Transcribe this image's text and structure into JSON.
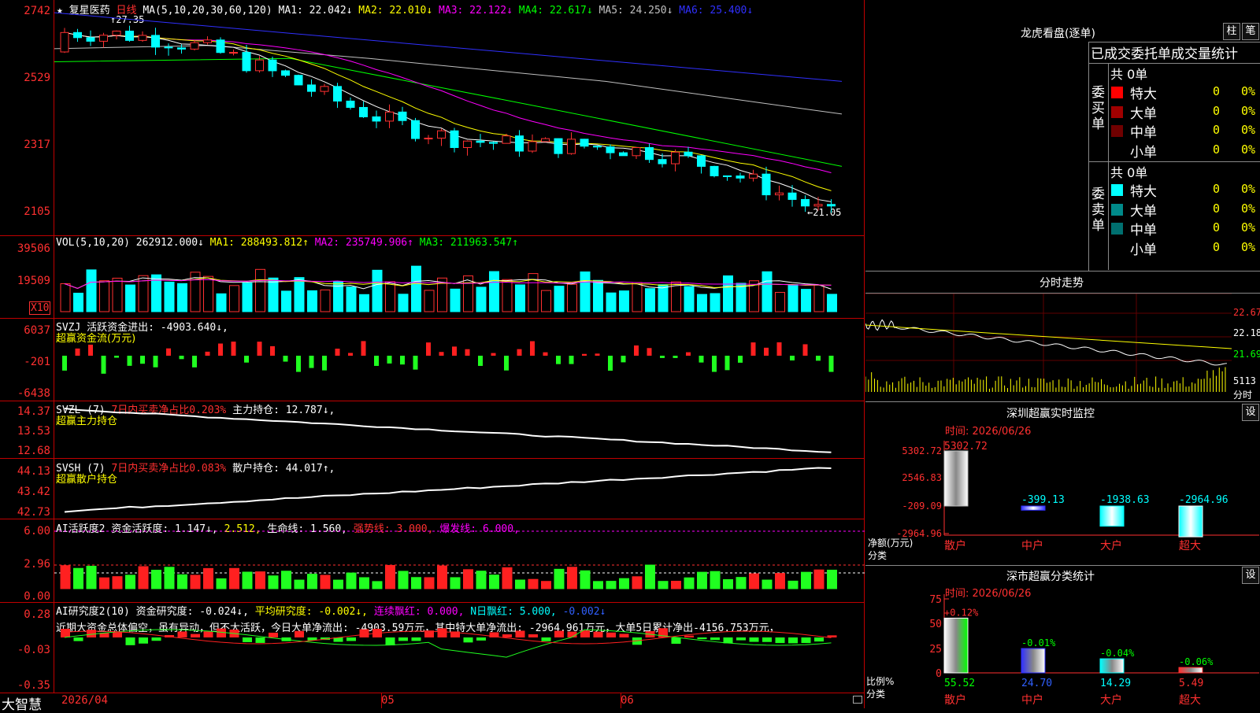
{
  "stock": {
    "name": "复星医药",
    "period": "日线",
    "star": "★",
    "ma_title": "MA(5,10,20,30,60,120)",
    "ma_values": [
      {
        "label": "MA1:",
        "value": "22.042↓",
        "color": "#ffffff"
      },
      {
        "label": "MA2:",
        "value": "22.010↓",
        "color": "#ffff00"
      },
      {
        "label": "MA3:",
        "value": "22.122↓",
        "color": "#ff00ff"
      },
      {
        "label": "MA4:",
        "value": "22.617↓",
        "color": "#00ff00"
      },
      {
        "label": "MA5:",
        "value": "24.250↓",
        "color": "#c0c0c0"
      },
      {
        "label": "MA6:",
        "value": "25.400↓",
        "color": "#3030ff"
      }
    ],
    "high_marker": "27.35",
    "low_marker": "←21.05",
    "price_ticks": [
      "2742",
      "2529",
      "2317",
      "2105"
    ]
  },
  "vol": {
    "title": "VOL(5,10,20)",
    "value": "262912.000↓",
    "ma1": "MA1: 288493.812↑",
    "ma2": "MA2: 235749.906↑",
    "ma3": "MA3: 211963.547↑",
    "ticks": [
      "39506",
      "19509"
    ],
    "unit": "X10"
  },
  "svzj": {
    "title": "SVZJ  活跃资金进出: -4903.640↓,",
    "subtitle": "超赢资金流(万元)",
    "ticks": [
      "6037",
      "-201",
      "-6438"
    ]
  },
  "svzl": {
    "title": "SVZL (7)",
    "ratio": "7日内买卖净占比0.203%",
    "hold": "主力持仓: 12.787↓,",
    "subtitle": "超赢主力持仓",
    "ticks": [
      "14.37",
      "13.53",
      "12.68"
    ]
  },
  "svsh": {
    "title": "SVSH (7)",
    "ratio": "7日内买卖净占比0.083%",
    "hold": "散户持仓: 44.017↑,",
    "subtitle": "超赢散户持仓",
    "ticks": [
      "44.13",
      "43.42",
      "42.73"
    ]
  },
  "ai_act": {
    "title": "AI活跃度2",
    "fund": "资金活跃度: 1.147↓,",
    "v2": "2.512,",
    "life": "生命线: 1.560,",
    "strong": "强势线: 3.000,",
    "burst": "爆发线: 6.000,",
    "ticks": [
      "6.00",
      "2.96",
      "0.00"
    ]
  },
  "ai_res": {
    "title": "AI研究度2(10)",
    "fund": "资金研究度: -0.024↓,",
    "avg": "平均研究度: -0.002↓,",
    "red": "连续飘红: 0.000,",
    "nred": "N日飘红: 5.000,",
    "last": "-0.002↓",
    "comment": "近期大资金总体偏空，虽有异动，但不太活跃，今日大单净流出: -4903.59万元，其中特大单净流出: -2964.961万元，大单5日累计净出-4156.753万元，",
    "ticks": [
      "0.28",
      "-0.03",
      "-0.35"
    ]
  },
  "footer": {
    "brand": "大智慧",
    "dates": [
      "2026/04",
      "05",
      "06"
    ]
  },
  "right": {
    "longhu_title": "龙虎看盘(逐单)",
    "btn_zhu": "柱",
    "btn_bi": "笔",
    "stats_title": "已成交委托单成交量统计",
    "buy_label": "委买单",
    "sell_label": "委卖单",
    "buy_total": "共 0单",
    "sell_total": "共 0单",
    "buy_rows": [
      {
        "name": "特大",
        "count": "0",
        "pct": "0%",
        "color": "#ff0000"
      },
      {
        "name": "大单",
        "count": "0",
        "pct": "0%",
        "color": "#a00000"
      },
      {
        "name": "中单",
        "count": "0",
        "pct": "0%",
        "color": "#700000"
      },
      {
        "name": "小单",
        "count": "0",
        "pct": "0%",
        "color": ""
      }
    ],
    "sell_rows": [
      {
        "name": "特大",
        "count": "0",
        "pct": "0%",
        "color": "#00ffff"
      },
      {
        "name": "大单",
        "count": "0",
        "pct": "0%",
        "color": "#008a8a"
      },
      {
        "name": "中单",
        "count": "0",
        "pct": "0%",
        "color": "#007070"
      },
      {
        "name": "小单",
        "count": "0",
        "pct": "0%",
        "color": ""
      }
    ],
    "fenshi_title": "分时走势",
    "fenshi_ticks": [
      "22.67",
      "22.18",
      "21.69"
    ],
    "fenshi_vol": "5113",
    "fenshi_label": "分时",
    "sz_monitor_title": "深圳超赢实时监控",
    "btn_set1": "设",
    "time1": "时间: 2026/06/26",
    "net_label": "净额(万元)",
    "cat_label": "分类",
    "net_ticks": [
      "5302.72",
      "2546.83",
      "-209.09",
      "-2964.96"
    ],
    "net_bars": [
      {
        "cat": "散户",
        "value": "5302.72"
      },
      {
        "cat": "中户",
        "value": "-399.13"
      },
      {
        "cat": "大户",
        "value": "-1938.63"
      },
      {
        "cat": "超大",
        "value": "-2964.96"
      }
    ],
    "sz_class_title": "深市超赢分类统计",
    "btn_set2": "设",
    "time2": "时间: 2026/06/26",
    "ratio_label": "比例%",
    "ratio_cat_label": "分类",
    "ratio_ticks": [
      "75",
      "50",
      "25",
      "0"
    ],
    "ratio_bars": [
      {
        "cat": "散户",
        "value": "55.52",
        "delta": "+0.12%"
      },
      {
        "cat": "中户",
        "value": "24.70",
        "delta": "-0.01%"
      },
      {
        "cat": "大户",
        "value": "14.29",
        "delta": "-0.04%"
      },
      {
        "cat": "超大",
        "value": "5.49",
        "delta": "-0.06%"
      }
    ]
  }
}
